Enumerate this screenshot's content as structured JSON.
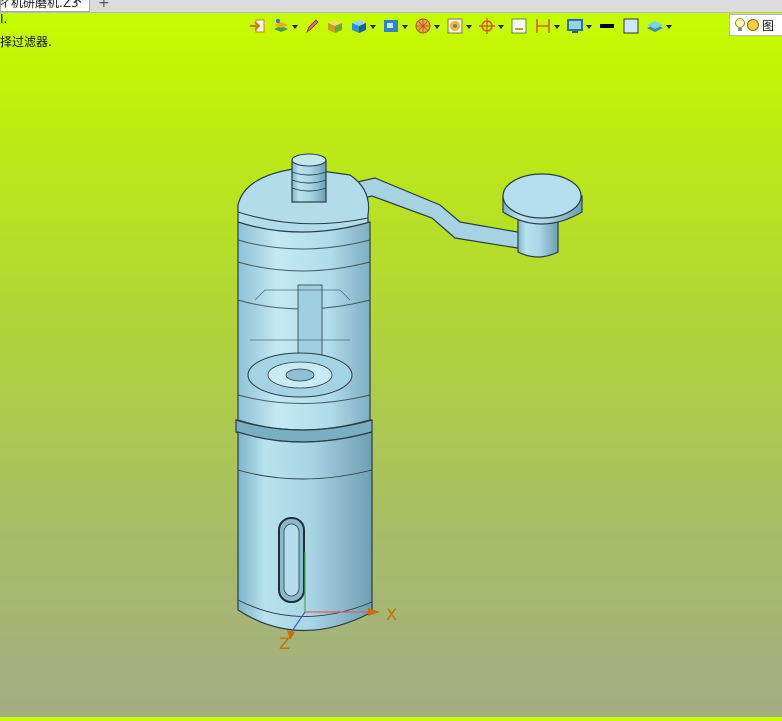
{
  "tab": {
    "title": "ㄔ机研磨机.Z3",
    "close_glyph": "✕",
    "new_glyph": "+"
  },
  "prompt": {
    "line1": "I.",
    "line2": "择过滤器."
  },
  "toolbar": {
    "items": [
      {
        "name": "exit-icon"
      },
      {
        "name": "layer-icon"
      },
      {
        "name": "pen-icon"
      },
      {
        "name": "box-yellow-icon"
      },
      {
        "name": "box-blue-icon"
      },
      {
        "name": "box-view-icon"
      },
      {
        "name": "sphere-icon"
      },
      {
        "name": "render-icon"
      },
      {
        "name": "target-icon"
      },
      {
        "name": "frame-icon"
      },
      {
        "name": "dimension-icon"
      },
      {
        "name": "screen-icon"
      },
      {
        "name": "color-black-icon"
      },
      {
        "name": "color-blue-icon"
      },
      {
        "name": "stack-icon"
      }
    ],
    "filter_label": "图"
  },
  "axes": {
    "x_label": "X",
    "z_label": "Z"
  },
  "colors": {
    "model_fill": "#a9d6e6",
    "model_dark": "#6fa8bf",
    "model_edge": "#2a3d47",
    "axis_label": "#c57000"
  }
}
